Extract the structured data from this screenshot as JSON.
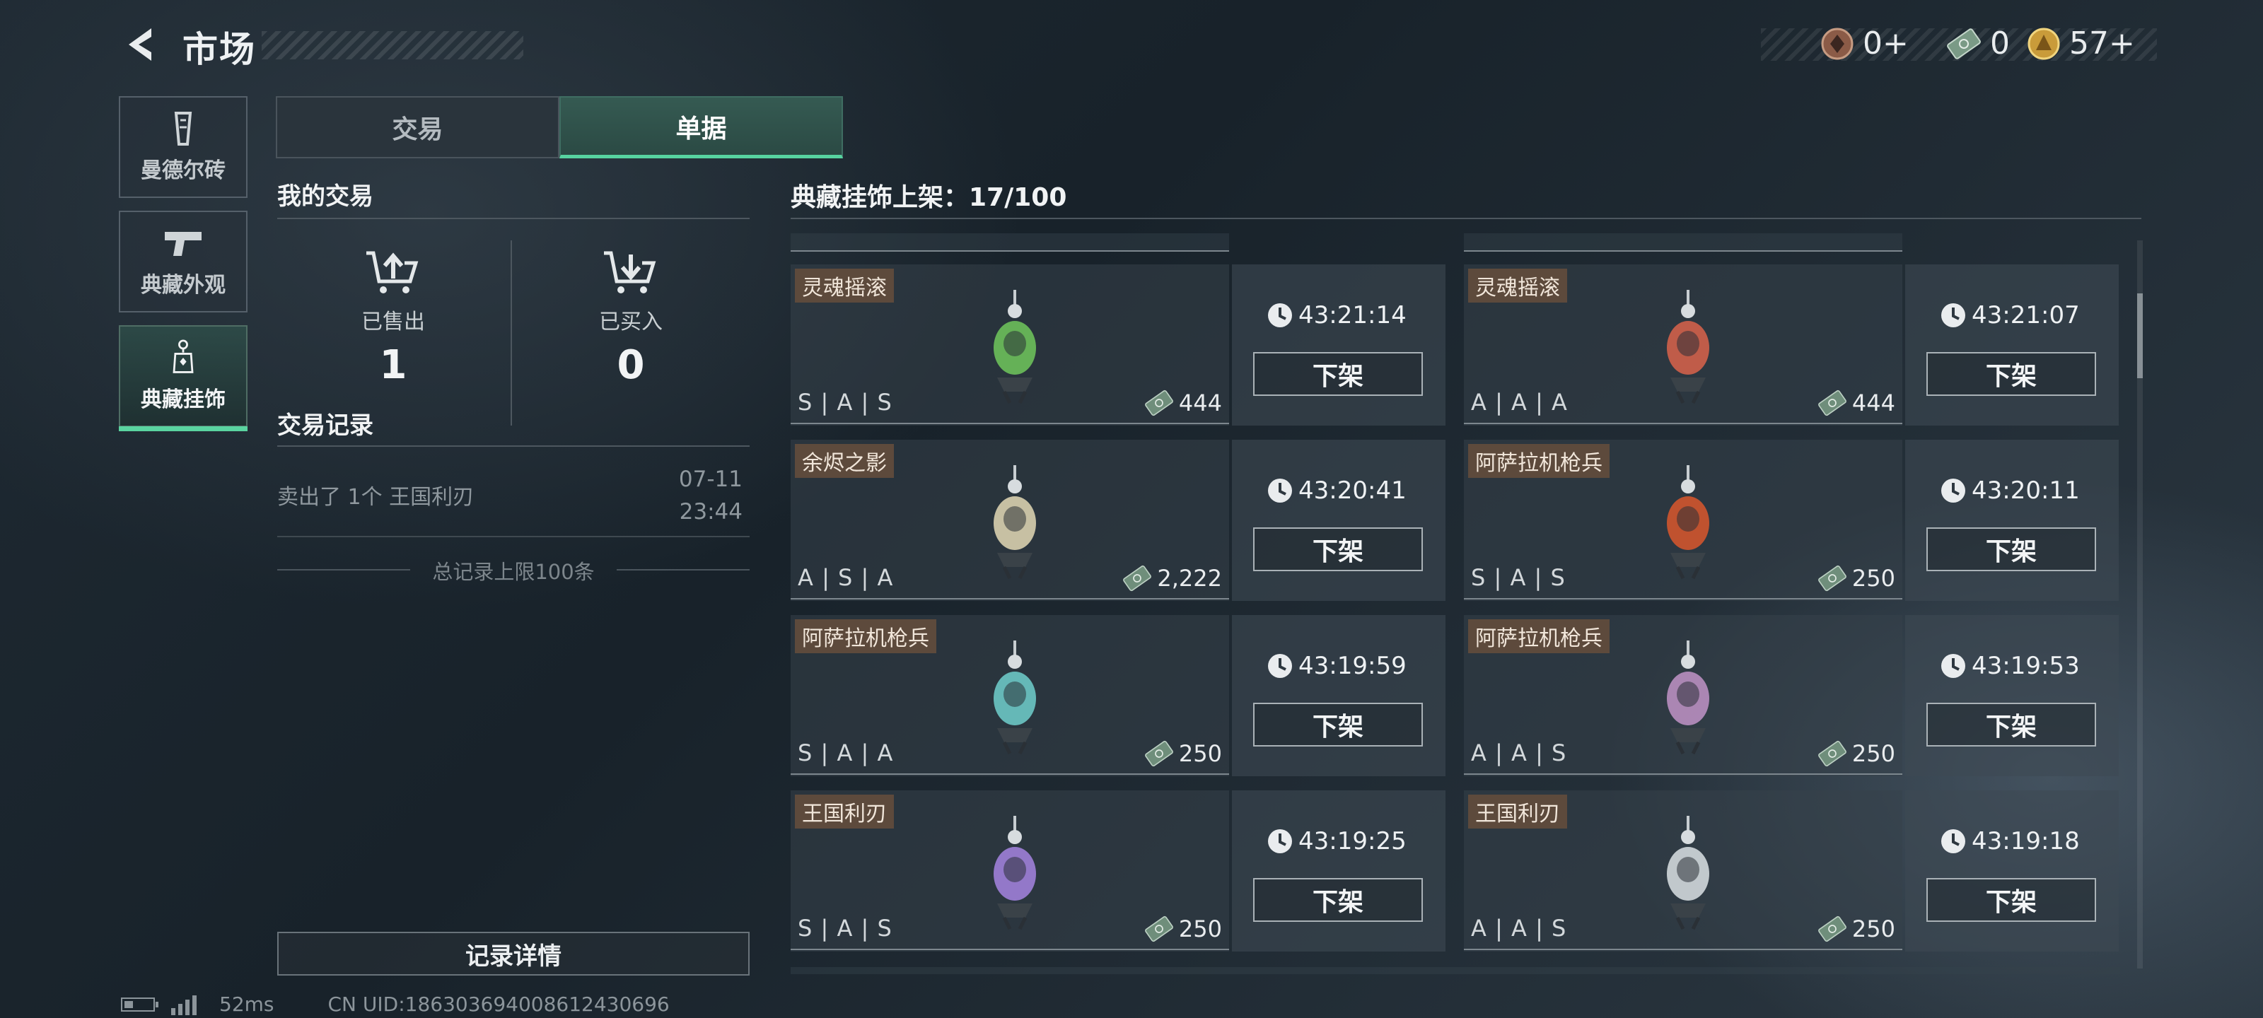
{
  "header": {
    "title": "市场",
    "currencies": [
      {
        "icon": "bronze-coin-icon",
        "value": "0+"
      },
      {
        "icon": "banknote-icon",
        "value": "0"
      },
      {
        "icon": "gold-coin-icon",
        "value": "57+"
      }
    ]
  },
  "sidebar": {
    "items": [
      {
        "label": "曼德尔砖",
        "icon": "brick-icon",
        "active": false
      },
      {
        "label": "典藏外观",
        "icon": "pistol-icon",
        "active": false
      },
      {
        "label": "典藏挂饰",
        "icon": "charm-icon",
        "active": true
      }
    ]
  },
  "tabs": [
    {
      "label": "交易",
      "active": false
    },
    {
      "label": "单据",
      "active": true
    }
  ],
  "my_trades": {
    "title": "我的交易",
    "sold_label": "已售出",
    "sold_value": "1",
    "bought_label": "已买入",
    "bought_value": "0"
  },
  "records": {
    "title": "交易记录",
    "items": [
      {
        "text": "卖出了 1个 王国利刃",
        "date": "07-11",
        "time": "23:44"
      }
    ],
    "limit_text": "总记录上限100条",
    "detail_button": "记录详情"
  },
  "listings": {
    "title": "典藏挂饰上架：17/100",
    "cards": [
      {
        "name": "灵魂摇滚",
        "grade": "S | A | S",
        "price": "444",
        "timer": "43:21:14",
        "button": "下架",
        "color": "#6bbf5a"
      },
      {
        "name": "灵魂摇滚",
        "grade": "A | A | A",
        "price": "444",
        "timer": "43:21:07",
        "button": "下架",
        "color": "#d0604a"
      },
      {
        "name": "余烬之影",
        "grade": "A | S | A",
        "price": "2,222",
        "timer": "43:20:41",
        "button": "下架",
        "color": "#d8cfae"
      },
      {
        "name": "阿萨拉机枪兵",
        "grade": "S | A | S",
        "price": "250",
        "timer": "43:20:11",
        "button": "下架",
        "color": "#d0552e"
      },
      {
        "name": "阿萨拉机枪兵",
        "grade": "S | A | A",
        "price": "250",
        "timer": "43:19:59",
        "button": "下架",
        "color": "#6bc6c4"
      },
      {
        "name": "阿萨拉机枪兵",
        "grade": "A | A | S",
        "price": "250",
        "timer": "43:19:53",
        "button": "下架",
        "color": "#b98fc0"
      },
      {
        "name": "王国利刃",
        "grade": "S | A | S",
        "price": "250",
        "timer": "43:19:25",
        "button": "下架",
        "color": "#9f7fd8"
      },
      {
        "name": "王国利刃",
        "grade": "A | A | S",
        "price": "250",
        "timer": "43:19:18",
        "button": "下架",
        "color": "#d2d8dc"
      }
    ]
  },
  "status_bar": {
    "ping": "52ms",
    "uid": "CN UID:1863036940086124306​96"
  }
}
